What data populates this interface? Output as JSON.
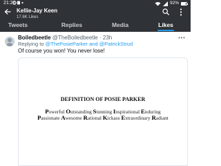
{
  "status_bar": {
    "time": "21:26",
    "battery": "92%",
    "battery_level": 0.92
  },
  "header": {
    "name": "Kellie-Jay Keen",
    "likes": "17.6K Likes"
  },
  "tabs": [
    {
      "label": "Tweets",
      "active": false
    },
    {
      "label": "Replies",
      "active": false
    },
    {
      "label": "Media",
      "active": false
    },
    {
      "label": "Likes",
      "active": true
    }
  ],
  "tweet": {
    "author_name": "Boiledbeetle",
    "author_handle": "@TheBoiledbeetle",
    "separator": "·",
    "time": "23h",
    "replying_label": "Replying to",
    "replying_handles": "@ThePosieParker and @PatrickStrud",
    "text": "Of course you won! You never lose!",
    "media": {
      "title": "DEFINITION OF POSIE PARKER",
      "line1_words": [
        "Powerful",
        "Outstanding",
        "Stunning",
        "Inspirational",
        "Enduring"
      ],
      "line2_words": [
        "Passionate",
        "Awesome",
        "Rational",
        "Kickass",
        "Extraordinary",
        "Radiant"
      ]
    }
  },
  "colors": {
    "header_bg": "#2f3236",
    "accent": "#1d9bf0",
    "text": "#0f1419",
    "muted": "#536471"
  }
}
